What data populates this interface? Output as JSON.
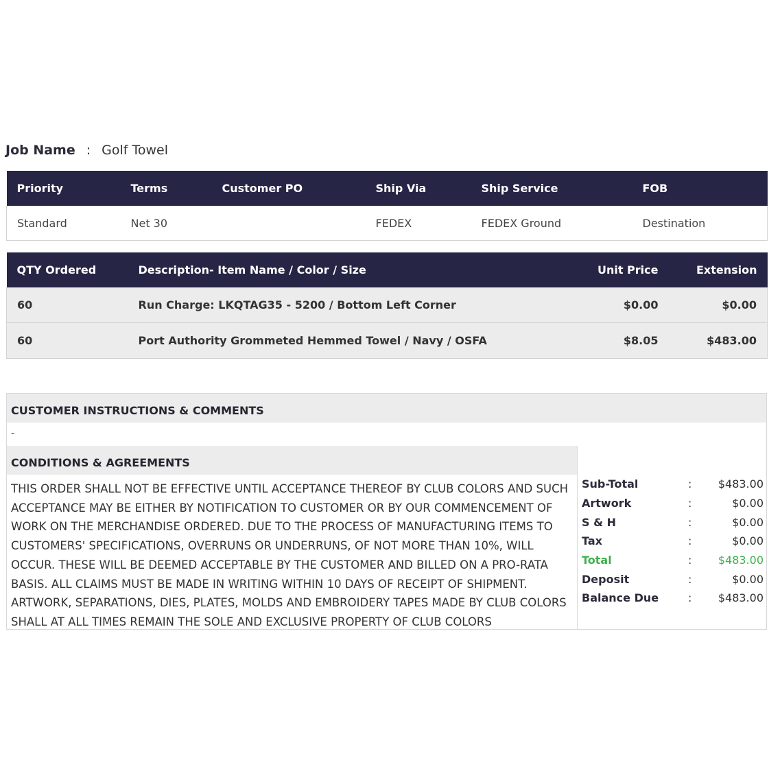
{
  "job": {
    "label": "Job Name",
    "separator": ":",
    "value": "Golf Towel"
  },
  "shipping_table": {
    "headers": [
      "Priority",
      "Terms",
      "Customer PO",
      "Ship Via",
      "Ship Service",
      "FOB"
    ],
    "row": [
      "Standard",
      "Net 30",
      "",
      "FEDEX",
      "FEDEX Ground",
      "Destination"
    ]
  },
  "items_table": {
    "headers": [
      "QTY Ordered",
      "Description- Item Name / Color / Size",
      "Unit Price",
      "Extension"
    ],
    "rows": [
      [
        "60",
        "Run Charge: LKQTAG35 - 5200 / Bottom Left Corner",
        "$0.00",
        "$0.00"
      ],
      [
        "60",
        "Port Authority Grommeted Hemmed Towel / Navy / OSFA",
        "$8.05",
        "$483.00"
      ]
    ]
  },
  "customer_instructions": {
    "title": "CUSTOMER INSTRUCTIONS & COMMENTS",
    "text": "-"
  },
  "conditions": {
    "title": "CONDITIONS & AGREEMENTS",
    "text": "THIS ORDER SHALL NOT BE EFFECTIVE UNTIL ACCEPTANCE THEREOF BY CLUB COLORS AND SUCH ACCEPTANCE MAY BE EITHER BY NOTIFICATION TO CUSTOMER OR BY OUR COMMENCEMENT OF WORK ON THE MERCHANDISE ORDERED. DUE TO THE PROCESS OF MANUFACTURING ITEMS TO CUSTOMERS' SPECIFICATIONS, OVERRUNS OR UNDERRUNS, OF NOT MORE THAN 10%, WILL OCCUR. THESE WILL BE DEEMED ACCEPTABLE BY THE CUSTOMER AND BILLED ON A PRO-RATA BASIS. ALL CLAIMS MUST BE MADE IN WRITING WITHIN 10 DAYS OF RECEIPT OF SHIPMENT. ARTWORK, SEPARATIONS, DIES, PLATES, MOLDS AND EMBROIDERY TAPES MADE BY CLUB COLORS SHALL AT ALL TIMES REMAIN THE SOLE AND EXCLUSIVE PROPERTY OF CLUB COLORS"
  },
  "totals": [
    {
      "label": "Sub-Total",
      "sep": ":",
      "value": "$483.00"
    },
    {
      "label": "Artwork",
      "sep": ":",
      "value": "$0.00"
    },
    {
      "label": "S & H",
      "sep": ":",
      "value": "$0.00"
    },
    {
      "label": "Tax",
      "sep": ":",
      "value": "$0.00"
    },
    {
      "label": "Total",
      "sep": ":",
      "value": "$483.00"
    },
    {
      "label": "Deposit",
      "sep": ":",
      "value": "$0.00"
    },
    {
      "label": "Balance Due",
      "sep": ":",
      "value": "$483.00"
    }
  ],
  "colors": {
    "header_bg": "#262545",
    "row_bg": "#ececec",
    "total_green": "#3cb24b"
  }
}
